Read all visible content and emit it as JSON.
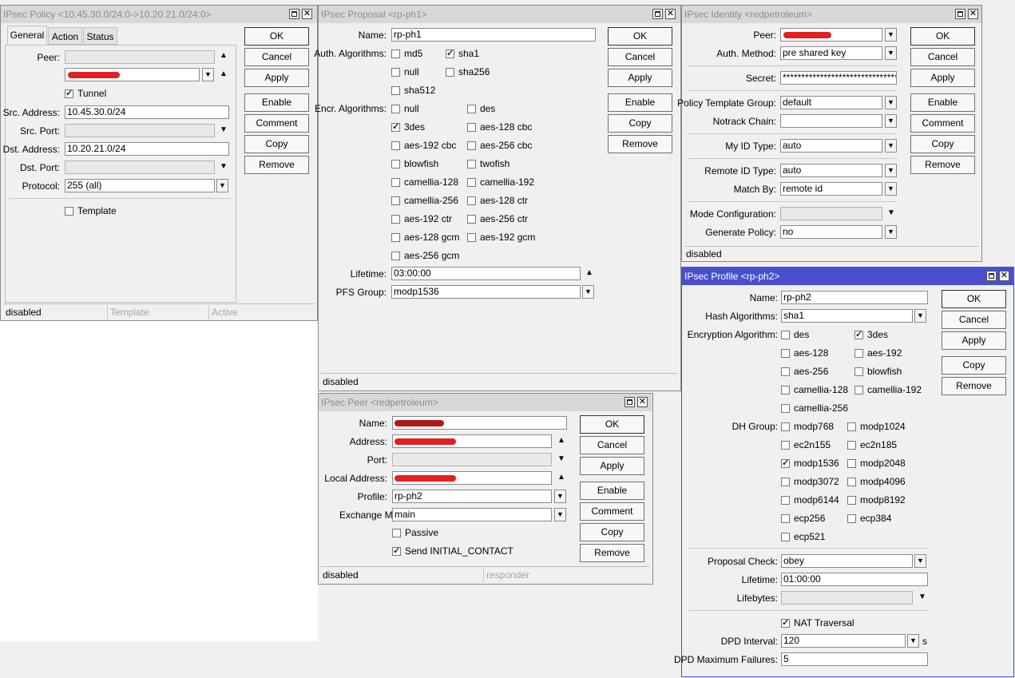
{
  "policy": {
    "title": "IPsec Policy <10.45.30.0/24:0->10.20.21.0/24:0>",
    "tabs": [
      "General",
      "Action",
      "Status"
    ],
    "labels": {
      "peer": "Peer:",
      "src_address": "Src. Address:",
      "src_port": "Src. Port:",
      "dst_address": "Dst. Address:",
      "dst_port": "Dst. Port:",
      "protocol": "Protocol:"
    },
    "tunnel_label": "Tunnel",
    "tunnel_checked": true,
    "src_address": "10.45.30.0/24",
    "dst_address": "10.20.21.0/24",
    "protocol": "255 (all)",
    "template_label": "Template",
    "template_checked": false,
    "buttons": [
      "OK",
      "Cancel",
      "Apply",
      "Enable",
      "Comment",
      "Copy",
      "Remove"
    ],
    "status": [
      "disabled",
      "Template",
      "Active"
    ]
  },
  "proposal": {
    "title": "IPsec Proposal <rp-ph1>",
    "labels": {
      "name": "Name:",
      "auth": "Auth. Algorithms:",
      "encr": "Encr. Algorithms:",
      "lifetime": "Lifetime:",
      "pfs": "PFS Group:"
    },
    "name": "rp-ph1",
    "auth": [
      {
        "label": "md5",
        "checked": false
      },
      {
        "label": "sha1",
        "checked": true
      },
      {
        "label": "null",
        "checked": false
      },
      {
        "label": "sha256",
        "checked": false
      },
      {
        "label": "sha512",
        "checked": false
      }
    ],
    "encr": [
      {
        "label": "null",
        "checked": false
      },
      {
        "label": "des",
        "checked": false
      },
      {
        "label": "3des",
        "checked": true
      },
      {
        "label": "aes-128 cbc",
        "checked": false
      },
      {
        "label": "aes-192 cbc",
        "checked": false
      },
      {
        "label": "aes-256 cbc",
        "checked": false
      },
      {
        "label": "blowfish",
        "checked": false
      },
      {
        "label": "twofish",
        "checked": false
      },
      {
        "label": "camellia-128",
        "checked": false
      },
      {
        "label": "camellia-192",
        "checked": false
      },
      {
        "label": "camellia-256",
        "checked": false
      },
      {
        "label": "aes-128 ctr",
        "checked": false
      },
      {
        "label": "aes-192 ctr",
        "checked": false
      },
      {
        "label": "aes-256 ctr",
        "checked": false
      },
      {
        "label": "aes-128 gcm",
        "checked": false
      },
      {
        "label": "aes-192 gcm",
        "checked": false
      },
      {
        "label": "aes-256 gcm",
        "checked": false
      }
    ],
    "lifetime": "03:00:00",
    "pfs_group": "modp1536",
    "buttons": [
      "OK",
      "Cancel",
      "Apply",
      "Enable",
      "Copy",
      "Remove"
    ],
    "status": "disabled"
  },
  "identity": {
    "title": "IPsec Identity <redpetroleum>",
    "labels": {
      "peer": "Peer:",
      "auth_method": "Auth. Method:",
      "secret": "Secret:",
      "policy_template_group": "Policy Template Group:",
      "notrack_chain": "Notrack Chain:",
      "my_id_type": "My ID Type:",
      "remote_id_type": "Remote ID Type:",
      "match_by": "Match By:",
      "mode_config": "Mode Configuration:",
      "generate_policy": "Generate Policy:"
    },
    "auth_method": "pre shared key",
    "secret": "**********************************",
    "policy_template_group": "default",
    "notrack_chain": "",
    "my_id_type": "auto",
    "remote_id_type": "auto",
    "match_by": "remote id",
    "generate_policy": "no",
    "buttons": [
      "OK",
      "Cancel",
      "Apply",
      "Enable",
      "Comment",
      "Copy",
      "Remove"
    ],
    "status": "disabled"
  },
  "peer": {
    "title": "IPsec Peer <redpetroleum>",
    "labels": {
      "name": "Name:",
      "address": "Address:",
      "port": "Port:",
      "local_address": "Local Address:",
      "profile": "Profile:",
      "exchange_mode": "Exchange Mode:"
    },
    "profile": "rp-ph2",
    "exchange_mode": "main",
    "passive_label": "Passive",
    "passive_checked": false,
    "send_initial_label": "Send INITIAL_CONTACT",
    "send_initial_checked": true,
    "buttons": [
      "OK",
      "Cancel",
      "Apply",
      "Enable",
      "Comment",
      "Copy",
      "Remove"
    ],
    "status": [
      "disabled",
      "responder"
    ]
  },
  "profile": {
    "title": "IPsec Profile <rp-ph2>",
    "labels": {
      "name": "Name:",
      "hash": "Hash Algorithms:",
      "enc": "Encryption Algorithm:",
      "dh": "DH Group:",
      "proposal_check": "Proposal Check:",
      "lifetime": "Lifetime:",
      "lifebytes": "Lifebytes:",
      "dpd_interval": "DPD Interval:",
      "dpd_max": "DPD Maximum Failures:"
    },
    "name": "rp-ph2",
    "hash": "sha1",
    "enc": [
      {
        "label": "des",
        "checked": false
      },
      {
        "label": "3des",
        "checked": true
      },
      {
        "label": "aes-128",
        "checked": false
      },
      {
        "label": "aes-192",
        "checked": false
      },
      {
        "label": "aes-256",
        "checked": false
      },
      {
        "label": "blowfish",
        "checked": false
      },
      {
        "label": "camellia-128",
        "checked": false
      },
      {
        "label": "camellia-192",
        "checked": false
      },
      {
        "label": "camellia-256",
        "checked": false
      }
    ],
    "dh": [
      {
        "label": "modp768",
        "checked": false
      },
      {
        "label": "modp1024",
        "checked": false
      },
      {
        "label": "ec2n155",
        "checked": false
      },
      {
        "label": "ec2n185",
        "checked": false
      },
      {
        "label": "modp1536",
        "checked": true
      },
      {
        "label": "modp2048",
        "checked": false
      },
      {
        "label": "modp3072",
        "checked": false
      },
      {
        "label": "modp4096",
        "checked": false
      },
      {
        "label": "modp6144",
        "checked": false
      },
      {
        "label": "modp8192",
        "checked": false
      },
      {
        "label": "ecp256",
        "checked": false
      },
      {
        "label": "ecp384",
        "checked": false
      },
      {
        "label": "ecp521",
        "checked": false
      }
    ],
    "proposal_check": "obey",
    "lifetime": "01:00:00",
    "nat_label": "NAT Traversal",
    "nat_checked": true,
    "dpd_interval": "120",
    "dpd_unit": "s",
    "dpd_max": "5",
    "buttons": [
      "OK",
      "Cancel",
      "Apply",
      "Copy",
      "Remove"
    ]
  }
}
